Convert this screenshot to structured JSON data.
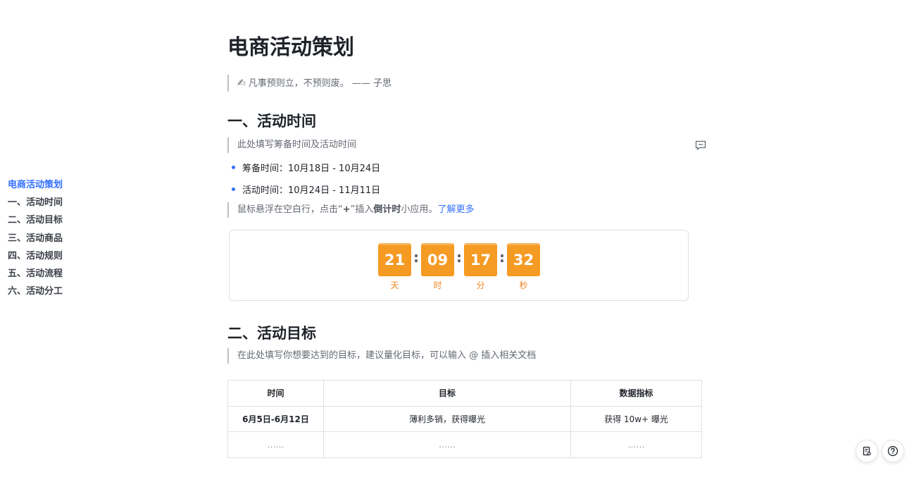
{
  "outline": {
    "items": [
      {
        "label": "电商活动策划",
        "active": true
      },
      {
        "label": "一、活动时间",
        "active": false
      },
      {
        "label": "二、活动目标",
        "active": false
      },
      {
        "label": "三、活动商品",
        "active": false
      },
      {
        "label": "四、活动规则",
        "active": false
      },
      {
        "label": "五、活动流程",
        "active": false
      },
      {
        "label": "六、活动分工",
        "active": false
      }
    ]
  },
  "doc": {
    "title": "电商活动策划",
    "quote": {
      "icon": "writing-hand",
      "emoji": "✍",
      "text": "凡事预则立，不预则废。 —— 子思"
    },
    "section1": {
      "heading": "一、活动时间",
      "note": "此处填写筹备时间及活动时间",
      "bullets": [
        {
          "label": "筹备时间：",
          "value": "10月18日 - 10月24日"
        },
        {
          "label": "活动时间：",
          "value": "10月24日 - 11月11日"
        }
      ],
      "hint_pre": "鼠标悬浮在空白行，点击“",
      "hint_plus": "+",
      "hint_mid": "”插入",
      "hint_bold": "倒计时",
      "hint_post": "小应用。",
      "hint_link": "了解更多"
    },
    "countdown": {
      "units": [
        {
          "value": "21",
          "label": "天"
        },
        {
          "value": "09",
          "label": "时"
        },
        {
          "value": "17",
          "label": "分"
        },
        {
          "value": "32",
          "label": "秒"
        }
      ],
      "separator": ":",
      "color": "#f59a23"
    },
    "section2": {
      "heading": "二、活动目标",
      "note": "在此处填写你想要达到的目标，建议量化目标，可以输入 @ 插入相关文档",
      "table": {
        "headers": [
          "时间",
          "目标",
          "数据指标"
        ],
        "rows": [
          [
            "6月5日-6月12日",
            "薄利多销，获得曝光",
            "获得 10w+ 曝光"
          ],
          [
            "……",
            "……",
            "……"
          ]
        ]
      }
    }
  },
  "colors": {
    "accent": "#3370ff",
    "countdown": "#f59a23"
  }
}
